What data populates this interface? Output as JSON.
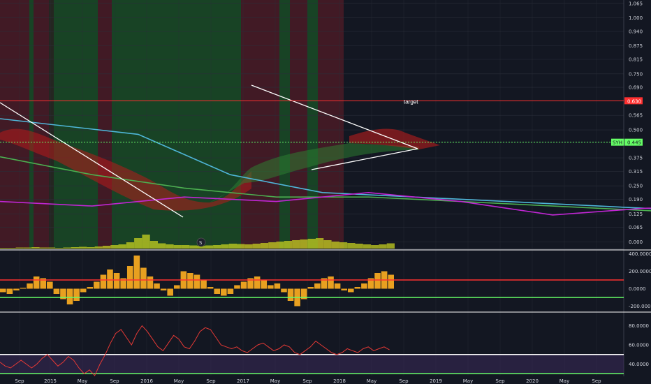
{
  "colors": {
    "background": "#131722",
    "grid": "#2a2e39",
    "bull_zone": "#1f7a2a",
    "bear_zone": "#7a1f2a",
    "price_candle_up": "#2fd12f",
    "price_candle_down": "#e03a3a",
    "kijun": "#4caf50",
    "tenkan": "#4fb6d9",
    "lagging": "#c026d3",
    "cloud_bear": "#b71c1c",
    "cloud_bull": "#2e7d32",
    "trendline": "#ffffff",
    "target_line": "#ff3030",
    "current_line": "#66ff66",
    "volume": "#c5d020",
    "cci_bar": "#e8a020",
    "rsi_line": "#e53935",
    "rsi_band": "#3b2a5a"
  },
  "chart_data": [
    {
      "type": "line",
      "pane": "price",
      "title": "",
      "ylim": [
        -0.03,
        1.08
      ],
      "y_ticks": [
        "1.065",
        "1.000",
        "0.940",
        "0.875",
        "0.815",
        "0.750",
        "0.690",
        "0.630",
        "0.565",
        "0.500",
        "0.445",
        "0.375",
        "0.315",
        "0.250",
        "0.190",
        "0.125",
        "0.065",
        "0.000"
      ],
      "target": {
        "value": 0.63,
        "label": "target",
        "badge": "0.630"
      },
      "current": {
        "value": 0.445,
        "label": "SYH",
        "badge": "0.445"
      },
      "x_labels": [
        "Sep",
        "2015",
        "May",
        "Sep",
        "2016",
        "May",
        "Sep",
        "2017",
        "May",
        "Sep",
        "2018",
        "May",
        "Sep",
        "2019",
        "May",
        "Sep",
        "2020",
        "May",
        "Sep"
      ],
      "series": [
        {
          "name": "",
          "points": [
            [
              0,
              0.38
            ],
            [
              4,
              0.3
            ],
            [
              8,
              0.24
            ],
            [
              12,
              0.2
            ],
            [
              16,
              0.2
            ],
            [
              20,
              0.18
            ],
            [
              24,
              0.16
            ],
            [
              28,
              0.14
            ],
            [
              32,
              0.12
            ],
            [
              36,
              0.13
            ],
            [
              40,
              0.22
            ],
            [
              44,
              0.25
            ],
            [
              48,
              0.33
            ],
            [
              52,
              0.48
            ],
            [
              56,
              0.58
            ],
            [
              60,
              0.44
            ],
            [
              64,
              0.46
            ],
            [
              68,
              0.5
            ],
            [
              72,
              0.68
            ],
            [
              76,
              0.56
            ],
            [
              80,
              0.52
            ],
            [
              84,
              0.5
            ],
            [
              88,
              0.46
            ],
            [
              92,
              0.48
            ],
            [
              96,
              0.52
            ],
            [
              100,
              0.46
            ],
            [
              104,
              0.42
            ],
            [
              108,
              0.4
            ],
            [
              112,
              0.42
            ],
            [
              116,
              0.44
            ]
          ]
        },
        {
          "name": "",
          "points": [
            [
              0,
              0.55
            ],
            [
              6,
              0.48
            ],
            [
              10,
              0.3
            ],
            [
              14,
              0.22
            ],
            [
              18,
              0.2
            ],
            [
              22,
              0.18
            ],
            [
              26,
              0.16
            ],
            [
              30,
              0.14
            ],
            [
              34,
              0.13
            ],
            [
              38,
              0.14
            ],
            [
              42,
              0.2
            ],
            [
              46,
              0.22
            ],
            [
              50,
              0.3
            ],
            [
              54,
              0.4
            ],
            [
              58,
              0.42
            ],
            [
              62,
              0.42
            ],
            [
              66,
              0.45
            ],
            [
              70,
              0.58
            ],
            [
              74,
              0.55
            ],
            [
              78,
              0.5
            ],
            [
              82,
              0.48
            ],
            [
              86,
              0.46
            ],
            [
              90,
              0.47
            ],
            [
              94,
              0.5
            ],
            [
              98,
              0.48
            ],
            [
              102,
              0.44
            ],
            [
              106,
              0.42
            ],
            [
              110,
              0.43
            ],
            [
              114,
              0.44
            ],
            [
              116,
              0.44
            ]
          ]
        },
        {
          "name": "",
          "points": [
            [
              0,
              0.18
            ],
            [
              4,
              0.16
            ],
            [
              8,
              0.2
            ],
            [
              12,
              0.18
            ],
            [
              16,
              0.22
            ],
            [
              20,
              0.18
            ],
            [
              24,
              0.12
            ],
            [
              28,
              0.15
            ],
            [
              32,
              0.16
            ],
            [
              36,
              0.13
            ],
            [
              40,
              0.28
            ],
            [
              44,
              0.38
            ],
            [
              48,
              0.32
            ],
            [
              52,
              0.46
            ],
            [
              56,
              0.62
            ],
            [
              60,
              0.55
            ],
            [
              64,
              0.4
            ],
            [
              68,
              0.46
            ],
            [
              72,
              0.5
            ],
            [
              76,
              0.42
            ],
            [
              80,
              0.44
            ],
            [
              84,
              0.4
            ],
            [
              88,
              0.46
            ],
            [
              92,
              0.42
            ],
            [
              96,
              0.45
            ],
            [
              100,
              0.4
            ]
          ]
        }
      ],
      "volume": [
        2,
        2,
        3,
        3,
        4,
        3,
        3,
        2,
        3,
        4,
        5,
        4,
        6,
        8,
        10,
        12,
        18,
        30,
        40,
        22,
        15,
        12,
        10,
        10,
        9,
        8,
        9,
        10,
        12,
        14,
        13,
        12,
        14,
        16,
        18,
        20,
        22,
        24,
        26,
        28,
        30,
        24,
        20,
        18,
        16,
        14,
        12,
        10,
        12,
        15
      ]
    },
    {
      "type": "bar",
      "pane": "cci",
      "title": "",
      "ylim": [
        -260,
        420
      ],
      "y_ticks": [
        "400.0000",
        "200.0000",
        "0.0000",
        "-200.0000"
      ],
      "levels": [
        100,
        -100
      ],
      "values": [
        -40,
        -60,
        -20,
        10,
        60,
        140,
        120,
        80,
        -60,
        -120,
        -180,
        -140,
        -40,
        20,
        80,
        160,
        220,
        180,
        120,
        260,
        380,
        240,
        140,
        60,
        -20,
        -80,
        40,
        200,
        180,
        160,
        100,
        20,
        -60,
        -80,
        -60,
        40,
        80,
        120,
        140,
        100,
        40,
        60,
        -40,
        -140,
        -200,
        -120,
        20,
        60,
        120,
        140,
        60,
        -20,
        -40,
        20,
        60,
        120,
        180,
        200,
        160
      ]
    },
    {
      "type": "line",
      "pane": "rsi",
      "title": "",
      "ylim": [
        28,
        92
      ],
      "y_ticks": [
        "80.0000",
        "60.0000",
        "40.0000"
      ],
      "levels": [
        50,
        30
      ],
      "values": [
        42,
        38,
        36,
        40,
        44,
        40,
        36,
        40,
        46,
        50,
        44,
        38,
        42,
        48,
        44,
        36,
        30,
        34,
        28,
        40,
        50,
        62,
        72,
        76,
        68,
        60,
        72,
        80,
        74,
        66,
        58,
        54,
        62,
        70,
        66,
        58,
        56,
        64,
        74,
        78,
        76,
        68,
        60,
        58,
        56,
        58,
        54,
        52,
        56,
        60,
        62,
        58,
        54,
        56,
        60,
        58,
        52,
        50,
        54,
        58,
        64,
        60,
        56,
        52,
        50,
        52,
        56,
        54,
        52,
        56,
        58,
        54,
        56,
        58,
        55
      ]
    }
  ]
}
